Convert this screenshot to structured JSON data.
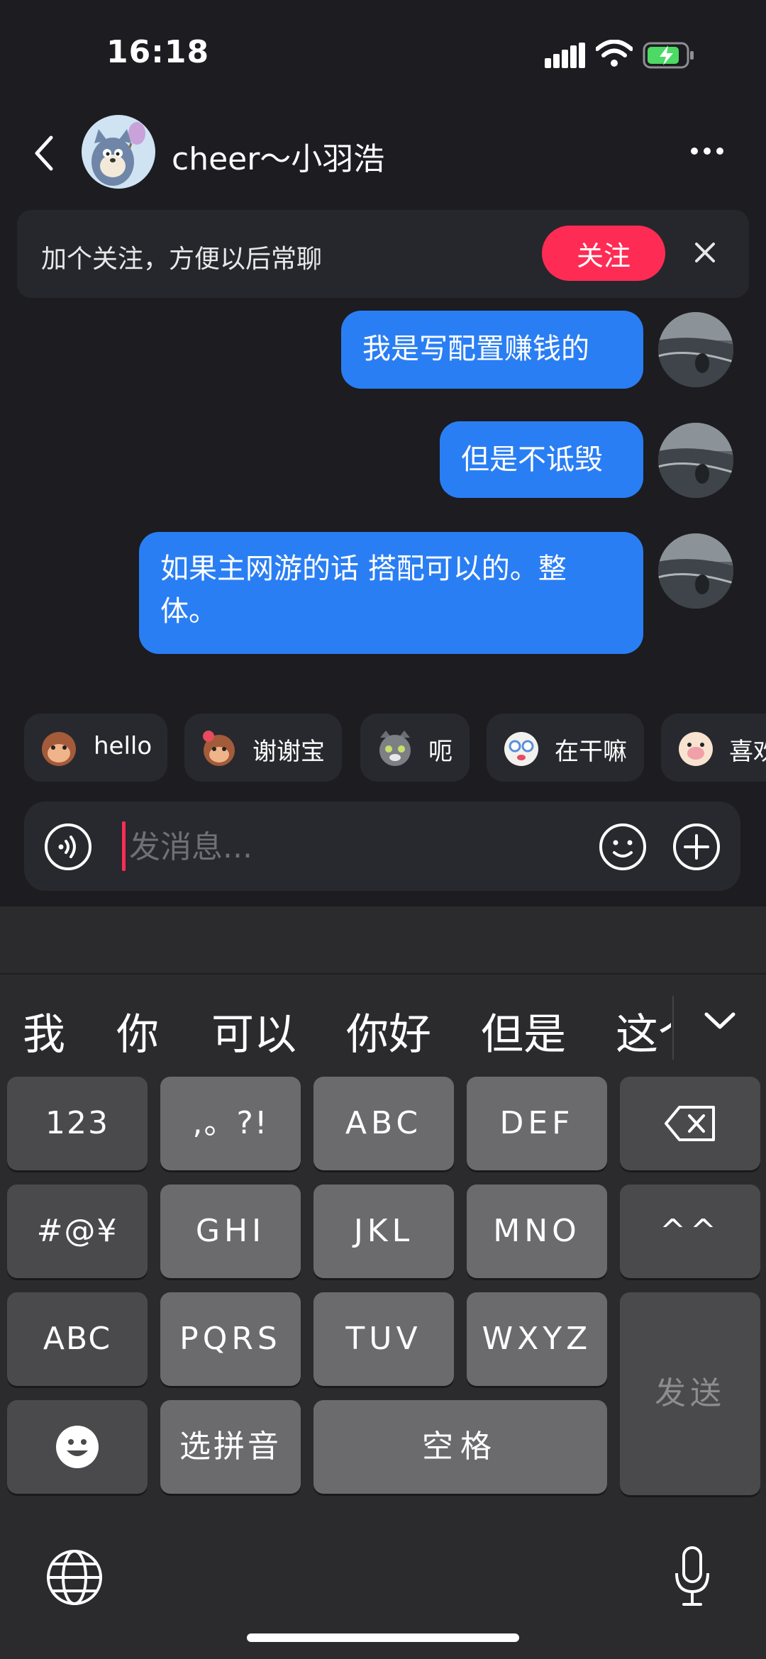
{
  "status": {
    "time": "16:18"
  },
  "header": {
    "contact_name": "cheer～小羽浩"
  },
  "follow_banner": {
    "text": "加个关注，方便以后常聊",
    "button": "关注"
  },
  "messages": [
    {
      "text": "我是写配置赚钱的"
    },
    {
      "text": "但是不诋毁"
    },
    {
      "text": "如果主网游的话 搭配可以的。整体。"
    }
  ],
  "quick_replies": [
    {
      "label": "hello",
      "icon": "monkey-emoji-icon"
    },
    {
      "label": "谢谢宝",
      "icon": "flower-monkey-emoji-icon"
    },
    {
      "label": "呃",
      "icon": "cat-emoji-icon"
    },
    {
      "label": "在干嘛",
      "icon": "bear-emoji-icon"
    },
    {
      "label": "喜欢",
      "icon": "piggy-emoji-icon"
    }
  ],
  "input": {
    "placeholder": "发消息..."
  },
  "keyboard": {
    "candidates": [
      "我",
      "你",
      "可以",
      "你好",
      "但是",
      "这个"
    ],
    "rows": [
      [
        "123",
        ",。?!",
        "ABC",
        "DEF",
        "⌫"
      ],
      [
        "#@¥",
        "GHI",
        "JKL",
        "MNO",
        "^^"
      ],
      [
        "ABC",
        "PQRS",
        "TUV",
        "WXYZ"
      ],
      [
        "☺",
        "选拼音",
        "空格"
      ]
    ],
    "send": "发送"
  },
  "colors": {
    "accent": "#fe2c55",
    "bubble": "#2a7ef4",
    "background": "#1c1c21"
  }
}
